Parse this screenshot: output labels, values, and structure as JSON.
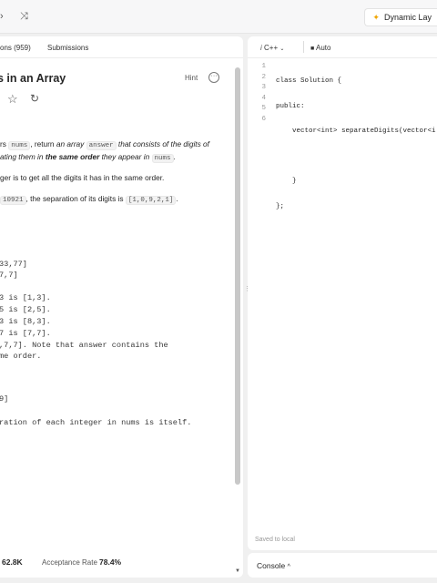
{
  "topbar": {
    "prev_icon": "›",
    "shuffle_icon": "⤨",
    "dynamic_layout_label": "Dynamic Lay"
  },
  "left_panel": {
    "tabs": [
      "ons (959)",
      "Submissions"
    ],
    "title": "s in an Array",
    "hint_label": "Hint",
    "description": {
      "p1_line1_a": "rs ",
      "p1_code1": "nums",
      "p1_line1_b": ", return ",
      "p1_line1_c": "an array ",
      "p1_code2": "answer",
      "p1_line1_d": " that consists of the digits of",
      "p1_line2_a": "ating them in ",
      "p1_line2_bold": "the same order",
      "p1_line2_b": " they appear in ",
      "p1_code3": "nums",
      "p1_line2_c": ".",
      "p2": "ger is to get all the digits it has in the same order.",
      "p3_code": "10921",
      "p3_a": ", the separation of its digits is ",
      "p3_code2": "[1,0,9,2,1]",
      "p3_b": "."
    },
    "example_lines": [
      "33,77]",
      "7,7]",
      "3 is [1,3].",
      "5 is [2,5].",
      "3 is [8,3].",
      "7 is [7,7].",
      ",7,7]. Note that answer contains the",
      "me order.",
      "9]",
      "ration of each integer in nums is itself."
    ],
    "stats": {
      "accepted_count": "62.8K",
      "acceptance_label": "Acceptance Rate",
      "acceptance_value": "78.4%"
    }
  },
  "editor": {
    "language": "C++",
    "mode": "Auto",
    "line_numbers": [
      "1",
      "2",
      "3",
      "4",
      "5",
      "6"
    ],
    "code_lines": [
      "class Solution {",
      "public:",
      "    vector<int> separateDigits(vector<i",
      "",
      "    }",
      "};"
    ],
    "saved_status": "Saved to local"
  },
  "console": {
    "label": "Console"
  }
}
